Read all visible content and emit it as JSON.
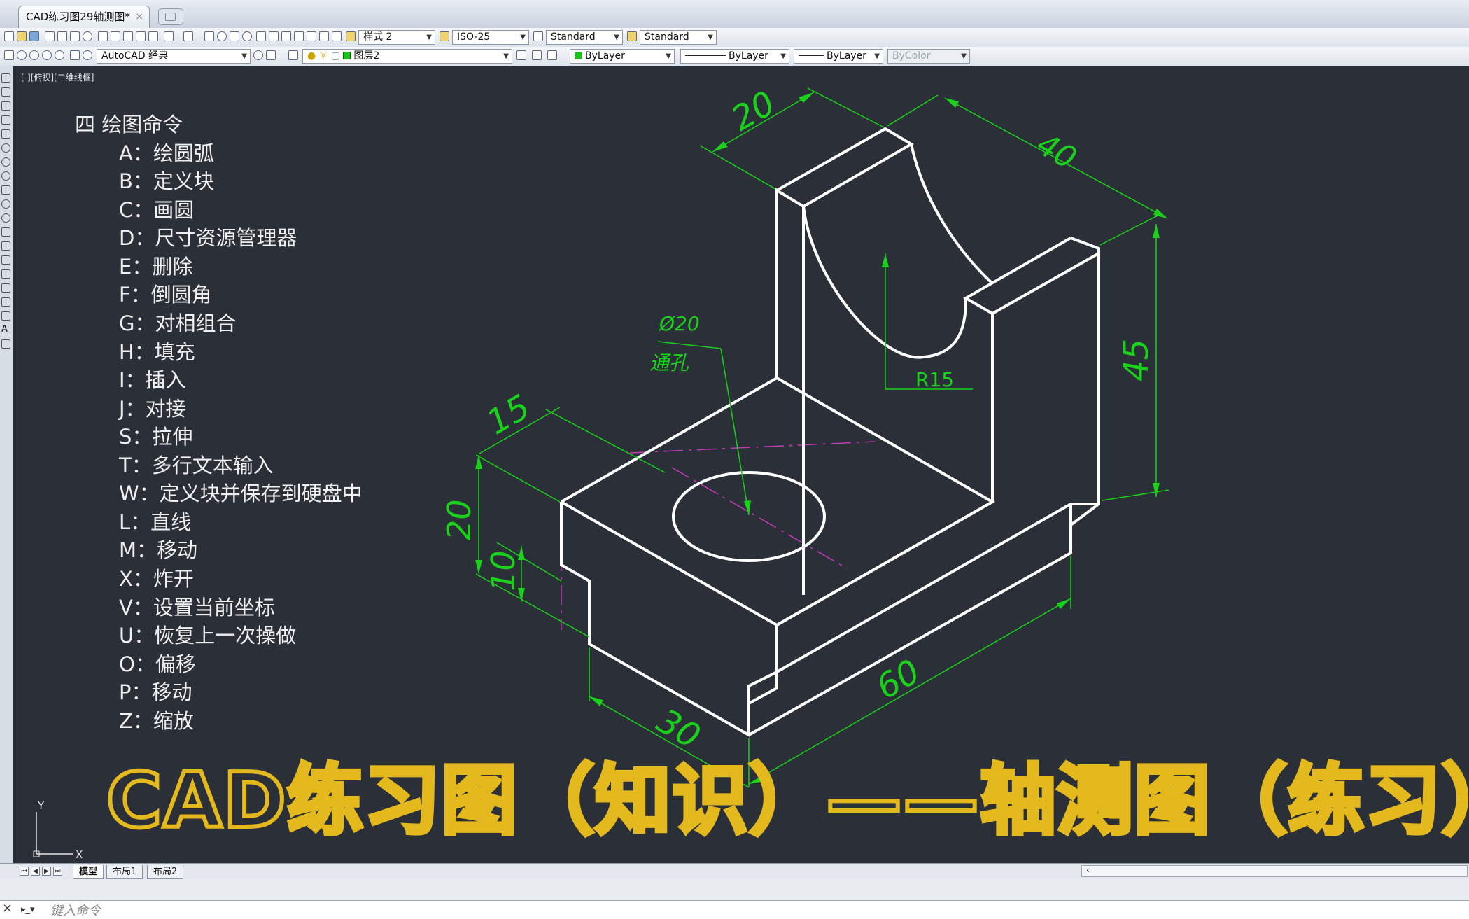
{
  "window": {
    "tab_title": "CAD练习图29轴测图*",
    "tab_close": "×"
  },
  "toolbar": {
    "text_style": "样式 2",
    "dim_style": "ISO-25",
    "table_style": "Standard",
    "multileader_style": "Standard",
    "workspace": "AutoCAD 经典",
    "layer": "图层2",
    "color": "ByLayer",
    "linetype": "ByLayer",
    "lineweight": "ByLayer",
    "plot_style": "ByColor"
  },
  "viewport": {
    "label": "[-][俯视][二维线框]"
  },
  "commands": {
    "title": "四 绘图命令",
    "items": [
      "A：绘圆弧",
      "B：定义块",
      "C：画圆",
      "D：尺寸资源管理器",
      "E：删除",
      "F：倒圆角",
      "G：对相组合",
      "H：填充",
      "I：插入",
      "J：对接",
      "S：拉伸",
      "T：多行文本输入",
      "W：定义块并保存到硬盘中",
      "L：直线",
      "M：移动",
      "X：炸开",
      "V：设置当前坐标",
      "U：恢复上一次操做",
      "O：偏移",
      "P：移动",
      "Z：缩放"
    ]
  },
  "drawing": {
    "dims": {
      "top_width": "20",
      "depth": "40",
      "total_height": "45",
      "radius": "R15",
      "hole_dia": "Ø20",
      "hole_note": "通孔",
      "base_step": "15",
      "base_height": "20",
      "step_height": "10",
      "front_width": "30",
      "length": "60"
    },
    "colors": {
      "outline": "#ffffff",
      "dimension": "#19d219",
      "centerline": "#c63ab6",
      "banner": "#e3b91e",
      "background": "#2b2f38"
    }
  },
  "banner": {
    "text": "CAD练习图（知识）——轴测图（练习）"
  },
  "ucs": {
    "x": "X",
    "y": "Y"
  },
  "layout_tabs": [
    "模型",
    "布局1",
    "布局2"
  ],
  "scroll_arrow": "‹",
  "command_line": {
    "placeholder": "键入命令",
    "close": "×",
    "prompt": "▸_▾"
  }
}
